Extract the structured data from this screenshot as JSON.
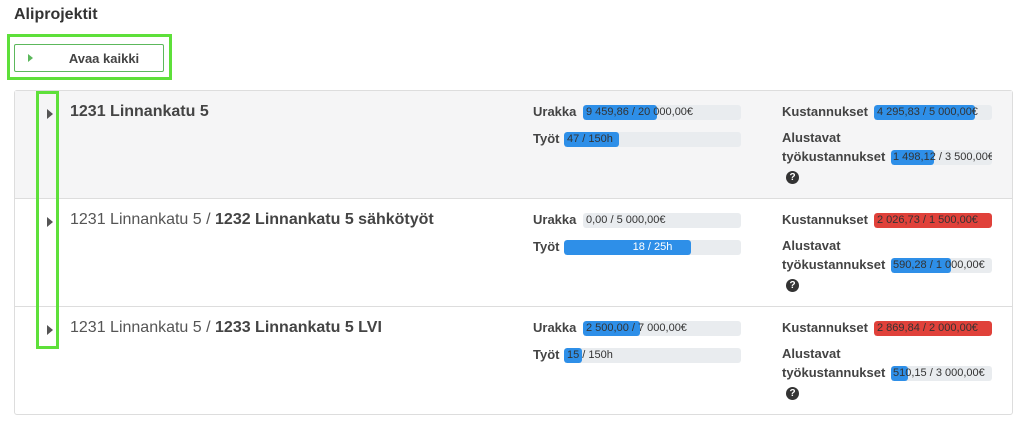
{
  "page": {
    "title": "Aliprojektit"
  },
  "open_all": {
    "label": "Avaa kaikki"
  },
  "labels": {
    "urakka": "Urakka",
    "tyot": "Työt",
    "kustannukset": "Kustannukset",
    "alustavat_1": "Alustavat",
    "alustavat_2": "työkustannukset",
    "help": "?"
  },
  "colors": {
    "blue": "#2e8fe8",
    "red": "#e0413a",
    "track": "#e9ecef",
    "highlight": "#5ee03a"
  },
  "projects": [
    {
      "parent": "",
      "name": "1231 Linnankatu 5",
      "urakka": {
        "text": "9 459,86 / 20 000,00€",
        "fraction": 0.47,
        "color": "#2e8fe8"
      },
      "tyot": {
        "text": "47 / 150h",
        "fraction": 0.31,
        "color": "#2e8fe8"
      },
      "kustannukset": {
        "text": "4 295,83 / 5 000,00€",
        "fraction": 0.86,
        "color": "#2e8fe8"
      },
      "alustavat": {
        "text": "1 498,12 / 3 500,00€",
        "fraction": 0.43,
        "color": "#2e8fe8"
      }
    },
    {
      "parent": "1231 Linnankatu 5 / ",
      "name": "1232 Linnankatu 5 sähkötyöt",
      "urakka": {
        "text": "0,00 / 5 000,00€",
        "fraction": 0.0,
        "color": "#2e8fe8"
      },
      "tyot": {
        "text": "18 / 25h",
        "fraction": 0.72,
        "color": "#2e8fe8"
      },
      "kustannukset": {
        "text": "2 026,73 / 1 500,00€",
        "fraction": 1.0,
        "color": "#e0413a"
      },
      "alustavat": {
        "text": "590,28 / 1 000,00€",
        "fraction": 0.59,
        "color": "#2e8fe8"
      }
    },
    {
      "parent": "1231 Linnankatu 5 / ",
      "name": "1233 Linnankatu 5 LVI",
      "urakka": {
        "text": "2 500,00 / 7 000,00€",
        "fraction": 0.36,
        "color": "#2e8fe8"
      },
      "tyot": {
        "text": "15 / 150h",
        "fraction": 0.1,
        "color": "#2e8fe8"
      },
      "kustannukset": {
        "text": "2 869,84 / 2 000,00€",
        "fraction": 1.0,
        "color": "#e0413a"
      },
      "alustavat": {
        "text": "510,15 / 3 000,00€",
        "fraction": 0.17,
        "color": "#2e8fe8"
      }
    }
  ]
}
